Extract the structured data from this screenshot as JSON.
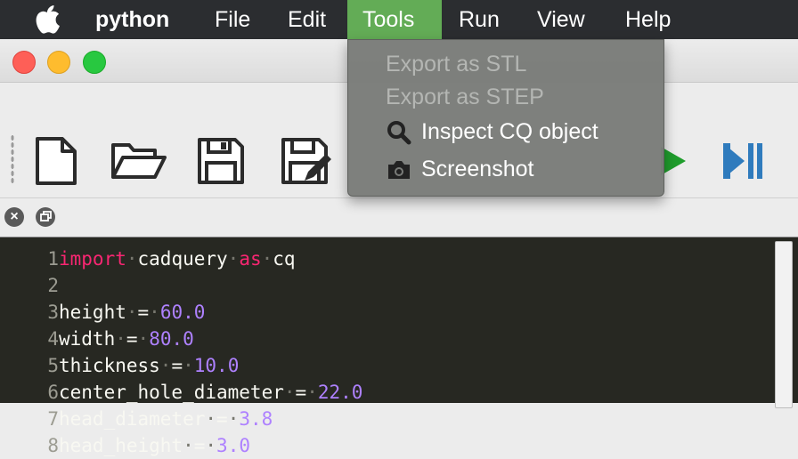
{
  "menubar": {
    "apple_icon": "apple-icon",
    "app_name": "python",
    "items": [
      "File",
      "Edit",
      "Tools",
      "Run",
      "View",
      "Help"
    ],
    "active_item": "Tools",
    "active_color": "#63ac56"
  },
  "window": {
    "traffic_lights": [
      "close",
      "minimize",
      "zoom"
    ]
  },
  "toolbar": {
    "buttons": [
      "new-file-icon",
      "open-folder-icon",
      "save-icon",
      "save-as-icon",
      "run-icon",
      "step-run-icon"
    ]
  },
  "dock": {
    "buttons": [
      "close-panel-icon",
      "float-panel-icon"
    ]
  },
  "tools_menu": {
    "items": [
      {
        "label": "Export as STL",
        "enabled": false
      },
      {
        "label": "Export as STEP",
        "enabled": false
      },
      {
        "label": "Inspect CQ object",
        "enabled": true,
        "icon": "magnifier-icon"
      },
      {
        "label": "Screenshot",
        "enabled": true,
        "icon": "camera-icon"
      }
    ]
  },
  "editor": {
    "lines": [
      {
        "n": "1",
        "code": "import cadquery as cq"
      },
      {
        "n": "2",
        "code": ""
      },
      {
        "n": "3",
        "code": "height = 60.0"
      },
      {
        "n": "4",
        "code": "width = 80.0"
      },
      {
        "n": "5",
        "code": "thickness = 10.0"
      },
      {
        "n": "6",
        "code": "center_hole_diameter = 22.0"
      },
      {
        "n": "7",
        "code": "head_diameter = 3.8"
      },
      {
        "n": "8",
        "code": "head_height = 3.0"
      }
    ],
    "colors": {
      "background": "#272822",
      "keyword": "#f92672",
      "number": "#ae81ff",
      "text": "#f8f8f2"
    }
  }
}
